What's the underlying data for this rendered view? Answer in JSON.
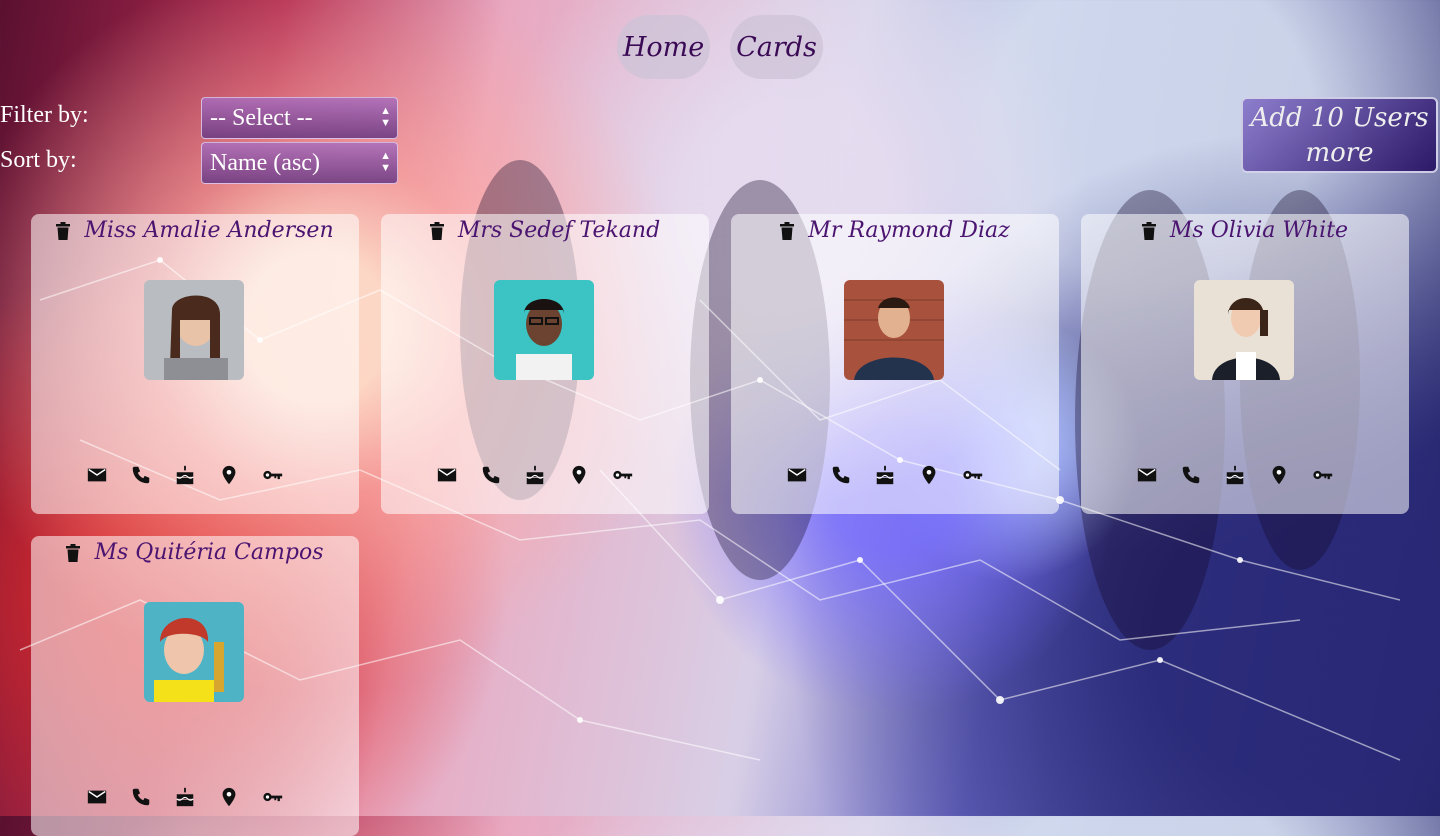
{
  "nav": {
    "home_label": "Home",
    "cards_label": "Cards"
  },
  "controls": {
    "filter_label": "Filter by:",
    "filter_value": "-- Select --",
    "sort_label": "Sort by:",
    "sort_value": "Name (asc)"
  },
  "add_button": {
    "label_line1": "Add 10 Users",
    "label_line2": "more"
  },
  "cards": [
    {
      "name": "Miss Amalie Andersen",
      "avatar": "woman-gray-sweater-photo"
    },
    {
      "name": "Mrs Sedef Tekand",
      "avatar": "woman-glasses-teal-photo"
    },
    {
      "name": "Mr Raymond Diaz",
      "avatar": "man-brick-wall-photo"
    },
    {
      "name": "Ms Olivia White",
      "avatar": "woman-black-vest-photo"
    },
    {
      "name": "Ms Quitéria Campos",
      "avatar": "woman-yellow-shirt-photo"
    }
  ],
  "card_icons": [
    "email-icon",
    "phone-icon",
    "birthday-cake-icon",
    "location-icon",
    "key-icon"
  ],
  "colors": {
    "name_text": "#4a1470",
    "nav_text": "#3a0a55"
  }
}
